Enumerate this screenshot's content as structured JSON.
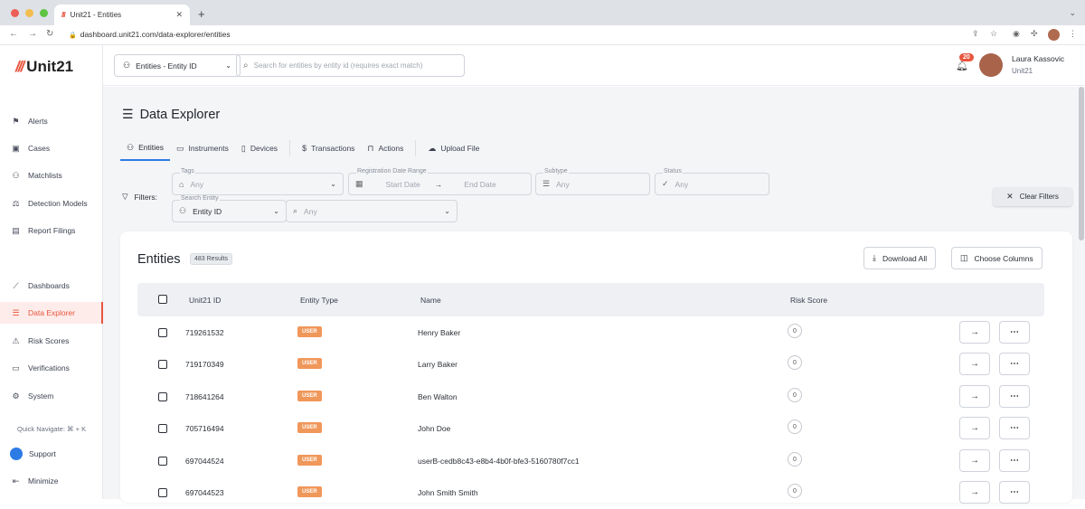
{
  "browser": {
    "tab_title": "Unit21 - Entities",
    "url": "dashboard.unit21.com/data-explorer/entities"
  },
  "brand": {
    "logo_text": "Unit21",
    "accent": "#e8553d",
    "primary": "#2d7be5"
  },
  "sidebar": {
    "items": [
      {
        "label": "Alerts",
        "icon": "flag-icon"
      },
      {
        "label": "Cases",
        "icon": "briefcase-icon"
      },
      {
        "label": "Matchlists",
        "icon": "user-plus-icon"
      },
      {
        "label": "Detection Models",
        "icon": "scale-icon"
      },
      {
        "label": "Report Filings",
        "icon": "document-icon"
      },
      {
        "label": "Dashboards",
        "icon": "chart-line-icon"
      },
      {
        "label": "Data Explorer",
        "icon": "search-list-icon",
        "active": true
      },
      {
        "label": "Risk Scores",
        "icon": "warning-triangle-icon"
      },
      {
        "label": "Verifications",
        "icon": "id-card-icon"
      },
      {
        "label": "System",
        "icon": "gear-icon"
      }
    ],
    "quick_navigate": "Quick Navigate: ⌘ + K",
    "support": "Support",
    "minimize": "Minimize"
  },
  "topbar": {
    "entity_select": "Entities - Entity ID",
    "search_placeholder": "Search for entities by entity id (requires exact match)",
    "notifications": "20",
    "user_name": "Laura Kassovic",
    "user_org": "Unit21"
  },
  "page": {
    "title": "Data Explorer",
    "tabs": [
      "Entities",
      "Instruments",
      "Devices",
      "Transactions",
      "Actions",
      "Upload File"
    ]
  },
  "filters": {
    "label": "Filters:",
    "tags_label": "Tags",
    "tags_placeholder": "Any",
    "date_label": "Registration Date Range",
    "start_date": "Start Date",
    "end_date": "End Date",
    "subtype_label": "Subtype",
    "subtype_placeholder": "Any",
    "status_label": "Status",
    "status_placeholder": "Any",
    "search_entity_label": "Search Entity",
    "search_entity_value": "Entity ID",
    "search_any": "Any",
    "clear": "Clear Filters"
  },
  "table": {
    "title": "Entities",
    "results": "483 Results",
    "download": "Download All",
    "choose_columns": "Choose Columns",
    "headers": [
      "Unit21 ID",
      "Entity Type",
      "Name",
      "Risk Score"
    ],
    "rows": [
      {
        "id": "719261532",
        "type": "USER",
        "name": "Henry Baker",
        "risk": "0"
      },
      {
        "id": "719170349",
        "type": "USER",
        "name": "Larry Baker",
        "risk": "0"
      },
      {
        "id": "718641264",
        "type": "USER",
        "name": "Ben Walton",
        "risk": "0"
      },
      {
        "id": "705716494",
        "type": "USER",
        "name": "John Doe",
        "risk": "0"
      },
      {
        "id": "697044524",
        "type": "USER",
        "name": "userB-cedb8c43-e8b4-4b0f-bfe3-5160780f7cc1",
        "risk": "0"
      },
      {
        "id": "697044523",
        "type": "USER",
        "name": "John Smith Smith",
        "risk": "0"
      }
    ]
  }
}
